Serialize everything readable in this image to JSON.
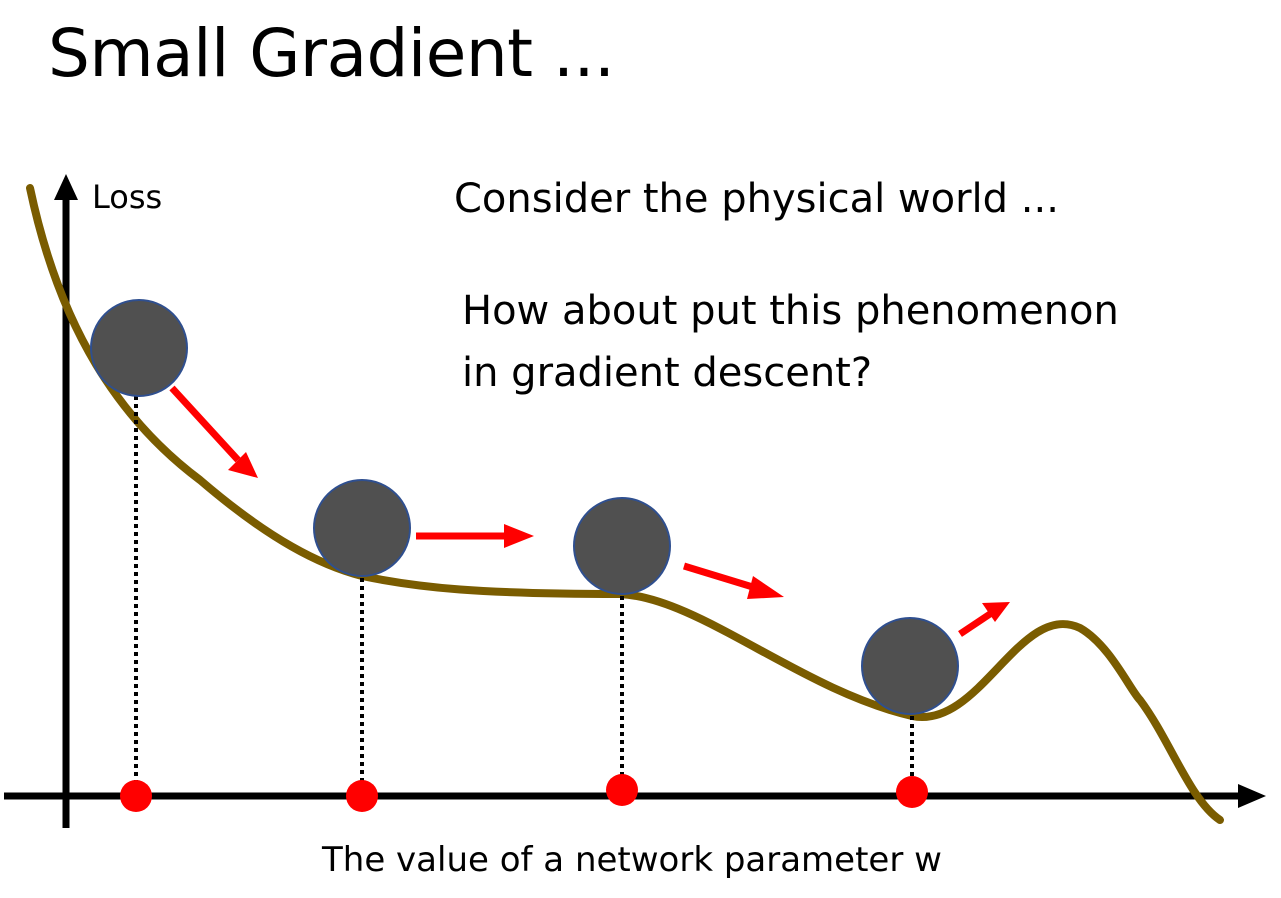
{
  "slide": {
    "title": "Small Gradient ...",
    "note_line1": "Consider the physical world ...",
    "note_line2a": "How about put this phenomenon",
    "note_line2b": "in gradient descent?"
  },
  "axes": {
    "y_label": "Loss",
    "x_label": "The value of a network parameter w"
  },
  "colors": {
    "curve": "#7a5c00",
    "ball": "#505050",
    "ball_outline": "#2f4f8f",
    "arrow": "#ff0000",
    "point": "#ff0000",
    "axis": "#000000"
  },
  "balls": [
    {
      "name": "ball-steep-slope"
    },
    {
      "name": "ball-gentle-slope"
    },
    {
      "name": "ball-plateau"
    },
    {
      "name": "ball-local-minimum"
    }
  ]
}
